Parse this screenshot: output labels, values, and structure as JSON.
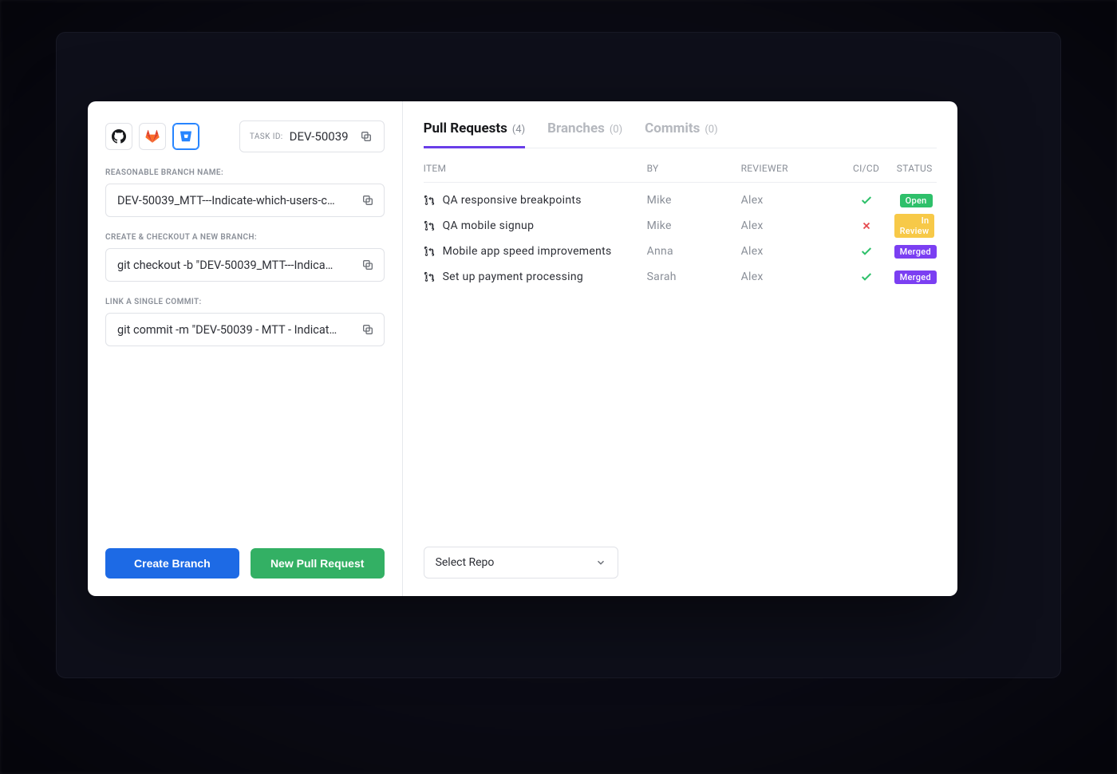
{
  "left": {
    "task_id_label": "TASK ID:",
    "task_id_value": "DEV-50039",
    "branch_label": "REASONABLE BRANCH NAME:",
    "branch_value": "DEV-50039_MTT---Indicate-which-users-c…",
    "checkout_label": "CREATE & CHECKOUT A NEW BRANCH:",
    "checkout_value": "git checkout -b \"DEV-50039_MTT---Indica…",
    "commit_label": "LINK A SINGLE COMMIT:",
    "commit_value": "git commit -m \"DEV-50039 - MTT - Indicat…",
    "create_branch_btn": "Create Branch",
    "new_pr_btn": "New Pull Request"
  },
  "tabs": {
    "pr_name": "Pull Requests",
    "pr_count": "(4)",
    "branches_name": "Branches",
    "branches_count": "(0)",
    "commits_name": "Commits",
    "commits_count": "(0)"
  },
  "headers": {
    "item": "ITEM",
    "by": "BY",
    "reviewer": "REVIEWER",
    "cicd": "CI/CD",
    "status": "STATUS"
  },
  "rows": [
    {
      "item": "QA responsive breakpoints",
      "by": "Mike",
      "reviewer": "Alex",
      "ci": "pass",
      "status": "Open",
      "status_class": "open"
    },
    {
      "item": "QA mobile signup",
      "by": "Mike",
      "reviewer": "Alex",
      "ci": "fail",
      "status": "In Review",
      "status_class": "review"
    },
    {
      "item": "Mobile app speed improvements",
      "by": "Anna",
      "reviewer": "Alex",
      "ci": "pass",
      "status": "Merged",
      "status_class": "merged"
    },
    {
      "item": "Set up payment processing",
      "by": "Sarah",
      "reviewer": "Alex",
      "ci": "pass",
      "status": "Merged",
      "status_class": "merged"
    }
  ],
  "select_repo": "Select Repo",
  "colors": {
    "open": "#2ec06a",
    "review": "#f7c948",
    "merged": "#7b3ff2",
    "pass": "#2ec06a",
    "fail": "#e5484d"
  }
}
